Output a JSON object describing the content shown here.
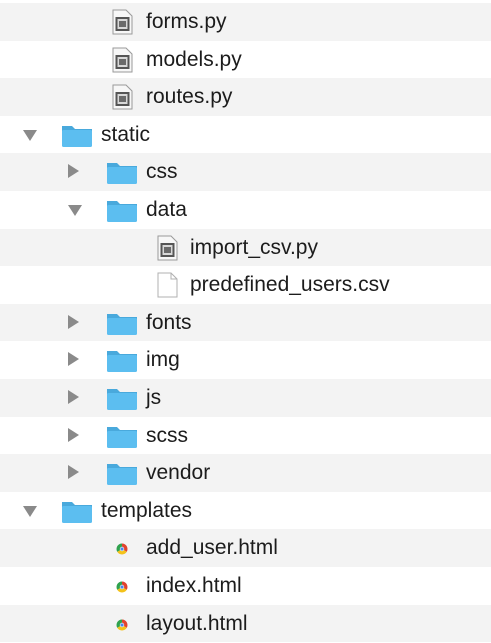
{
  "colors": {
    "folder_fill": "#5cbef0",
    "folder_tab": "#49a9dc",
    "row_alt": "#f3f3f3",
    "disclosure": "#8a8a8a",
    "text": "#1c1c1c"
  },
  "tree": {
    "rows": [
      {
        "label": "forms.py",
        "icon": "python-file-icon",
        "depth": 1,
        "disclosure": "none",
        "alt": true
      },
      {
        "label": "models.py",
        "icon": "python-file-icon",
        "depth": 1,
        "disclosure": "none",
        "alt": false
      },
      {
        "label": "routes.py",
        "icon": "python-file-icon",
        "depth": 1,
        "disclosure": "none",
        "alt": true
      },
      {
        "label": "static",
        "icon": "folder-icon",
        "depth": 0,
        "disclosure": "open",
        "alt": false
      },
      {
        "label": "css",
        "icon": "folder-icon",
        "depth": 1,
        "disclosure": "closed",
        "alt": true
      },
      {
        "label": "data",
        "icon": "folder-icon",
        "depth": 1,
        "disclosure": "open",
        "alt": false
      },
      {
        "label": "import_csv.py",
        "icon": "python-file-icon",
        "depth": 2,
        "disclosure": "none",
        "alt": true
      },
      {
        "label": "predefined_users.csv",
        "icon": "blank-file-icon",
        "depth": 2,
        "disclosure": "none",
        "alt": false
      },
      {
        "label": "fonts",
        "icon": "folder-icon",
        "depth": 1,
        "disclosure": "closed",
        "alt": true
      },
      {
        "label": "img",
        "icon": "folder-icon",
        "depth": 1,
        "disclosure": "closed",
        "alt": false
      },
      {
        "label": "js",
        "icon": "folder-icon",
        "depth": 1,
        "disclosure": "closed",
        "alt": true
      },
      {
        "label": "scss",
        "icon": "folder-icon",
        "depth": 1,
        "disclosure": "closed",
        "alt": false
      },
      {
        "label": "vendor",
        "icon": "folder-icon",
        "depth": 1,
        "disclosure": "closed",
        "alt": true
      },
      {
        "label": "templates",
        "icon": "folder-icon",
        "depth": 0,
        "disclosure": "open",
        "alt": false
      },
      {
        "label": "add_user.html",
        "icon": "chrome-html-file-icon",
        "depth": 1,
        "disclosure": "none",
        "alt": true
      },
      {
        "label": "index.html",
        "icon": "chrome-html-file-icon",
        "depth": 1,
        "disclosure": "none",
        "alt": false
      },
      {
        "label": "layout.html",
        "icon": "chrome-html-file-icon",
        "depth": 1,
        "disclosure": "none",
        "alt": true
      }
    ]
  }
}
